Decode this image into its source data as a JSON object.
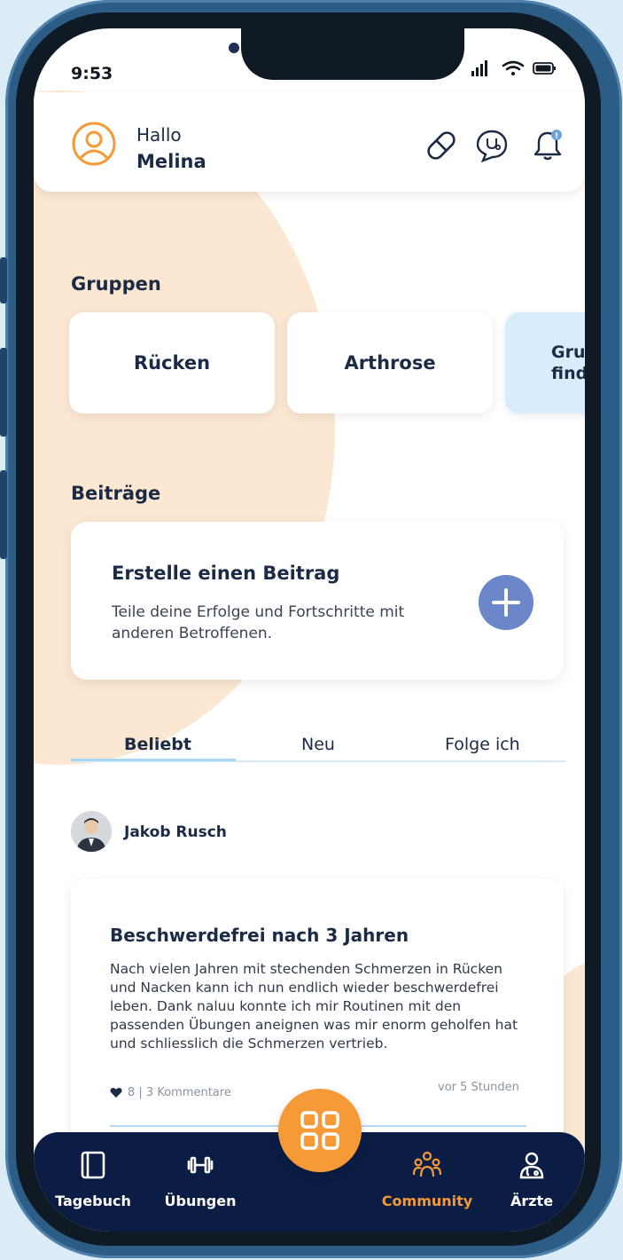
{
  "status_bar": {
    "time": "9:53"
  },
  "header": {
    "greeting": "Hallo",
    "user_name": "Melina",
    "icons": [
      "pill-icon",
      "doctor-chat-icon",
      "bell-icon"
    ],
    "notification_badge": "!"
  },
  "groups": {
    "title": "Gruppen",
    "items": [
      "Rücken",
      "Arthrose"
    ],
    "find_label_line1": "Grup",
    "find_label_line2": "find"
  },
  "posts_section": {
    "title": "Beiträge",
    "create_title": "Erstelle einen Beitrag",
    "create_desc": "Teile deine Erfolge und Fortschritte mit anderen Betroffenen."
  },
  "tabs": [
    "Beliebt",
    "Neu",
    "Folge ich"
  ],
  "active_tab": "Beliebt",
  "post": {
    "author": "Jakob Rusch",
    "title": "Beschwerdefrei nach 3 Jahren",
    "body": "Nach vielen Jahren mit stechenden Schmerzen in Rücken und Nacken kann ich nun endlich wieder beschwerdefrei leben. Dank naluu konnte ich mir Routinen mit den passenden Übungen aneignen was mir enorm geholfen hat und schliesslich die Schmerzen vertrieb.",
    "stats": "8 | 3 Kommentare",
    "time_ago": "vor 5 Stunden"
  },
  "bottom_nav": {
    "items": [
      {
        "label": "Tagebuch",
        "icon": "diary-icon"
      },
      {
        "label": "Übungen",
        "icon": "dumbbell-icon"
      },
      {
        "label": "Community",
        "icon": "community-icon"
      },
      {
        "label": "Ärzte",
        "icon": "doctor-icon"
      }
    ],
    "active": "Community"
  },
  "colors": {
    "accent_orange": "#f59a37",
    "navy": "#0c1d45",
    "text_dark": "#1b2b45",
    "light_blue": "#d8edfb",
    "peach": "#fbe7d2",
    "plus_blue": "#6b86c9"
  }
}
